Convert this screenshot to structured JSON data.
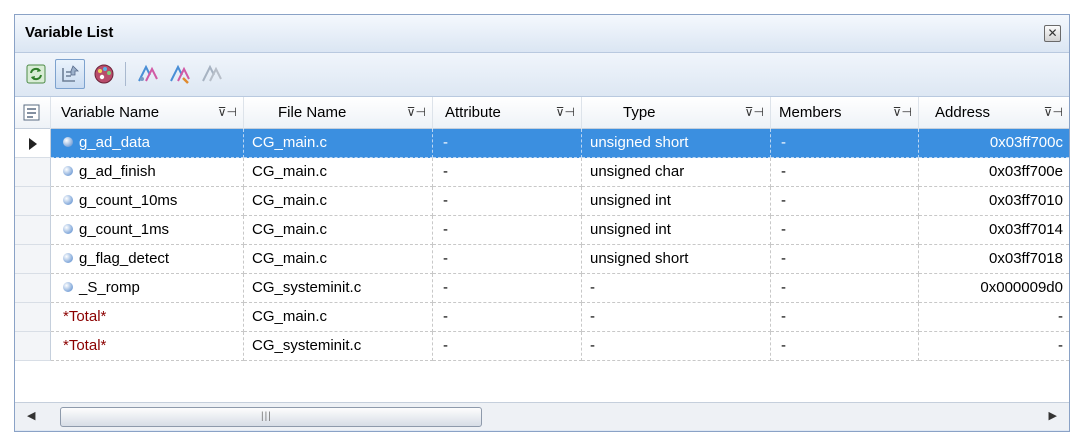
{
  "window": {
    "title": "Variable List",
    "close_glyph": "✕"
  },
  "toolbar": {
    "buttons": [
      {
        "name": "refresh-icon",
        "pressed": false
      },
      {
        "name": "display-option-icon",
        "pressed": true
      },
      {
        "name": "palette-icon",
        "pressed": false
      },
      {
        "name": "function-list-icon",
        "pressed": false
      },
      {
        "name": "function-list-alt-icon",
        "pressed": false
      },
      {
        "name": "function-list-disabled-icon",
        "pressed": false
      }
    ]
  },
  "columns": [
    "Variable Name",
    "File Name",
    "Attribute",
    "Type",
    "Members",
    "Address"
  ],
  "filter_glyph": "⊽⊣",
  "rows": [
    {
      "name": "g_ad_data",
      "file": "CG_main.c",
      "attribute": "-",
      "type": "unsigned short",
      "members": "-",
      "address": "0x03ff700c",
      "icon": true,
      "selected": true,
      "total": false
    },
    {
      "name": "g_ad_finish",
      "file": "CG_main.c",
      "attribute": "-",
      "type": "unsigned char",
      "members": "-",
      "address": "0x03ff700e",
      "icon": true,
      "selected": false,
      "total": false
    },
    {
      "name": "g_count_10ms",
      "file": "CG_main.c",
      "attribute": "-",
      "type": "unsigned int",
      "members": "-",
      "address": "0x03ff7010",
      "icon": true,
      "selected": false,
      "total": false
    },
    {
      "name": "g_count_1ms",
      "file": "CG_main.c",
      "attribute": "-",
      "type": "unsigned int",
      "members": "-",
      "address": "0x03ff7014",
      "icon": true,
      "selected": false,
      "total": false
    },
    {
      "name": "g_flag_detect",
      "file": "CG_main.c",
      "attribute": "-",
      "type": "unsigned short",
      "members": "-",
      "address": "0x03ff7018",
      "icon": true,
      "selected": false,
      "total": false
    },
    {
      "name": "_S_romp",
      "file": "CG_systeminit.c",
      "attribute": "-",
      "type": "-",
      "members": "-",
      "address": "0x000009d0",
      "icon": true,
      "selected": false,
      "total": false
    },
    {
      "name": "*Total*",
      "file": "CG_main.c",
      "attribute": "-",
      "type": "-",
      "members": "-",
      "address": "-",
      "icon": false,
      "selected": false,
      "total": true
    },
    {
      "name": "*Total*",
      "file": "CG_systeminit.c",
      "attribute": "-",
      "type": "-",
      "members": "-",
      "address": "-",
      "icon": false,
      "selected": false,
      "total": true
    }
  ],
  "scrollbar": {
    "left_arrow": "◀",
    "right_arrow": "▶",
    "grip": "|||"
  }
}
